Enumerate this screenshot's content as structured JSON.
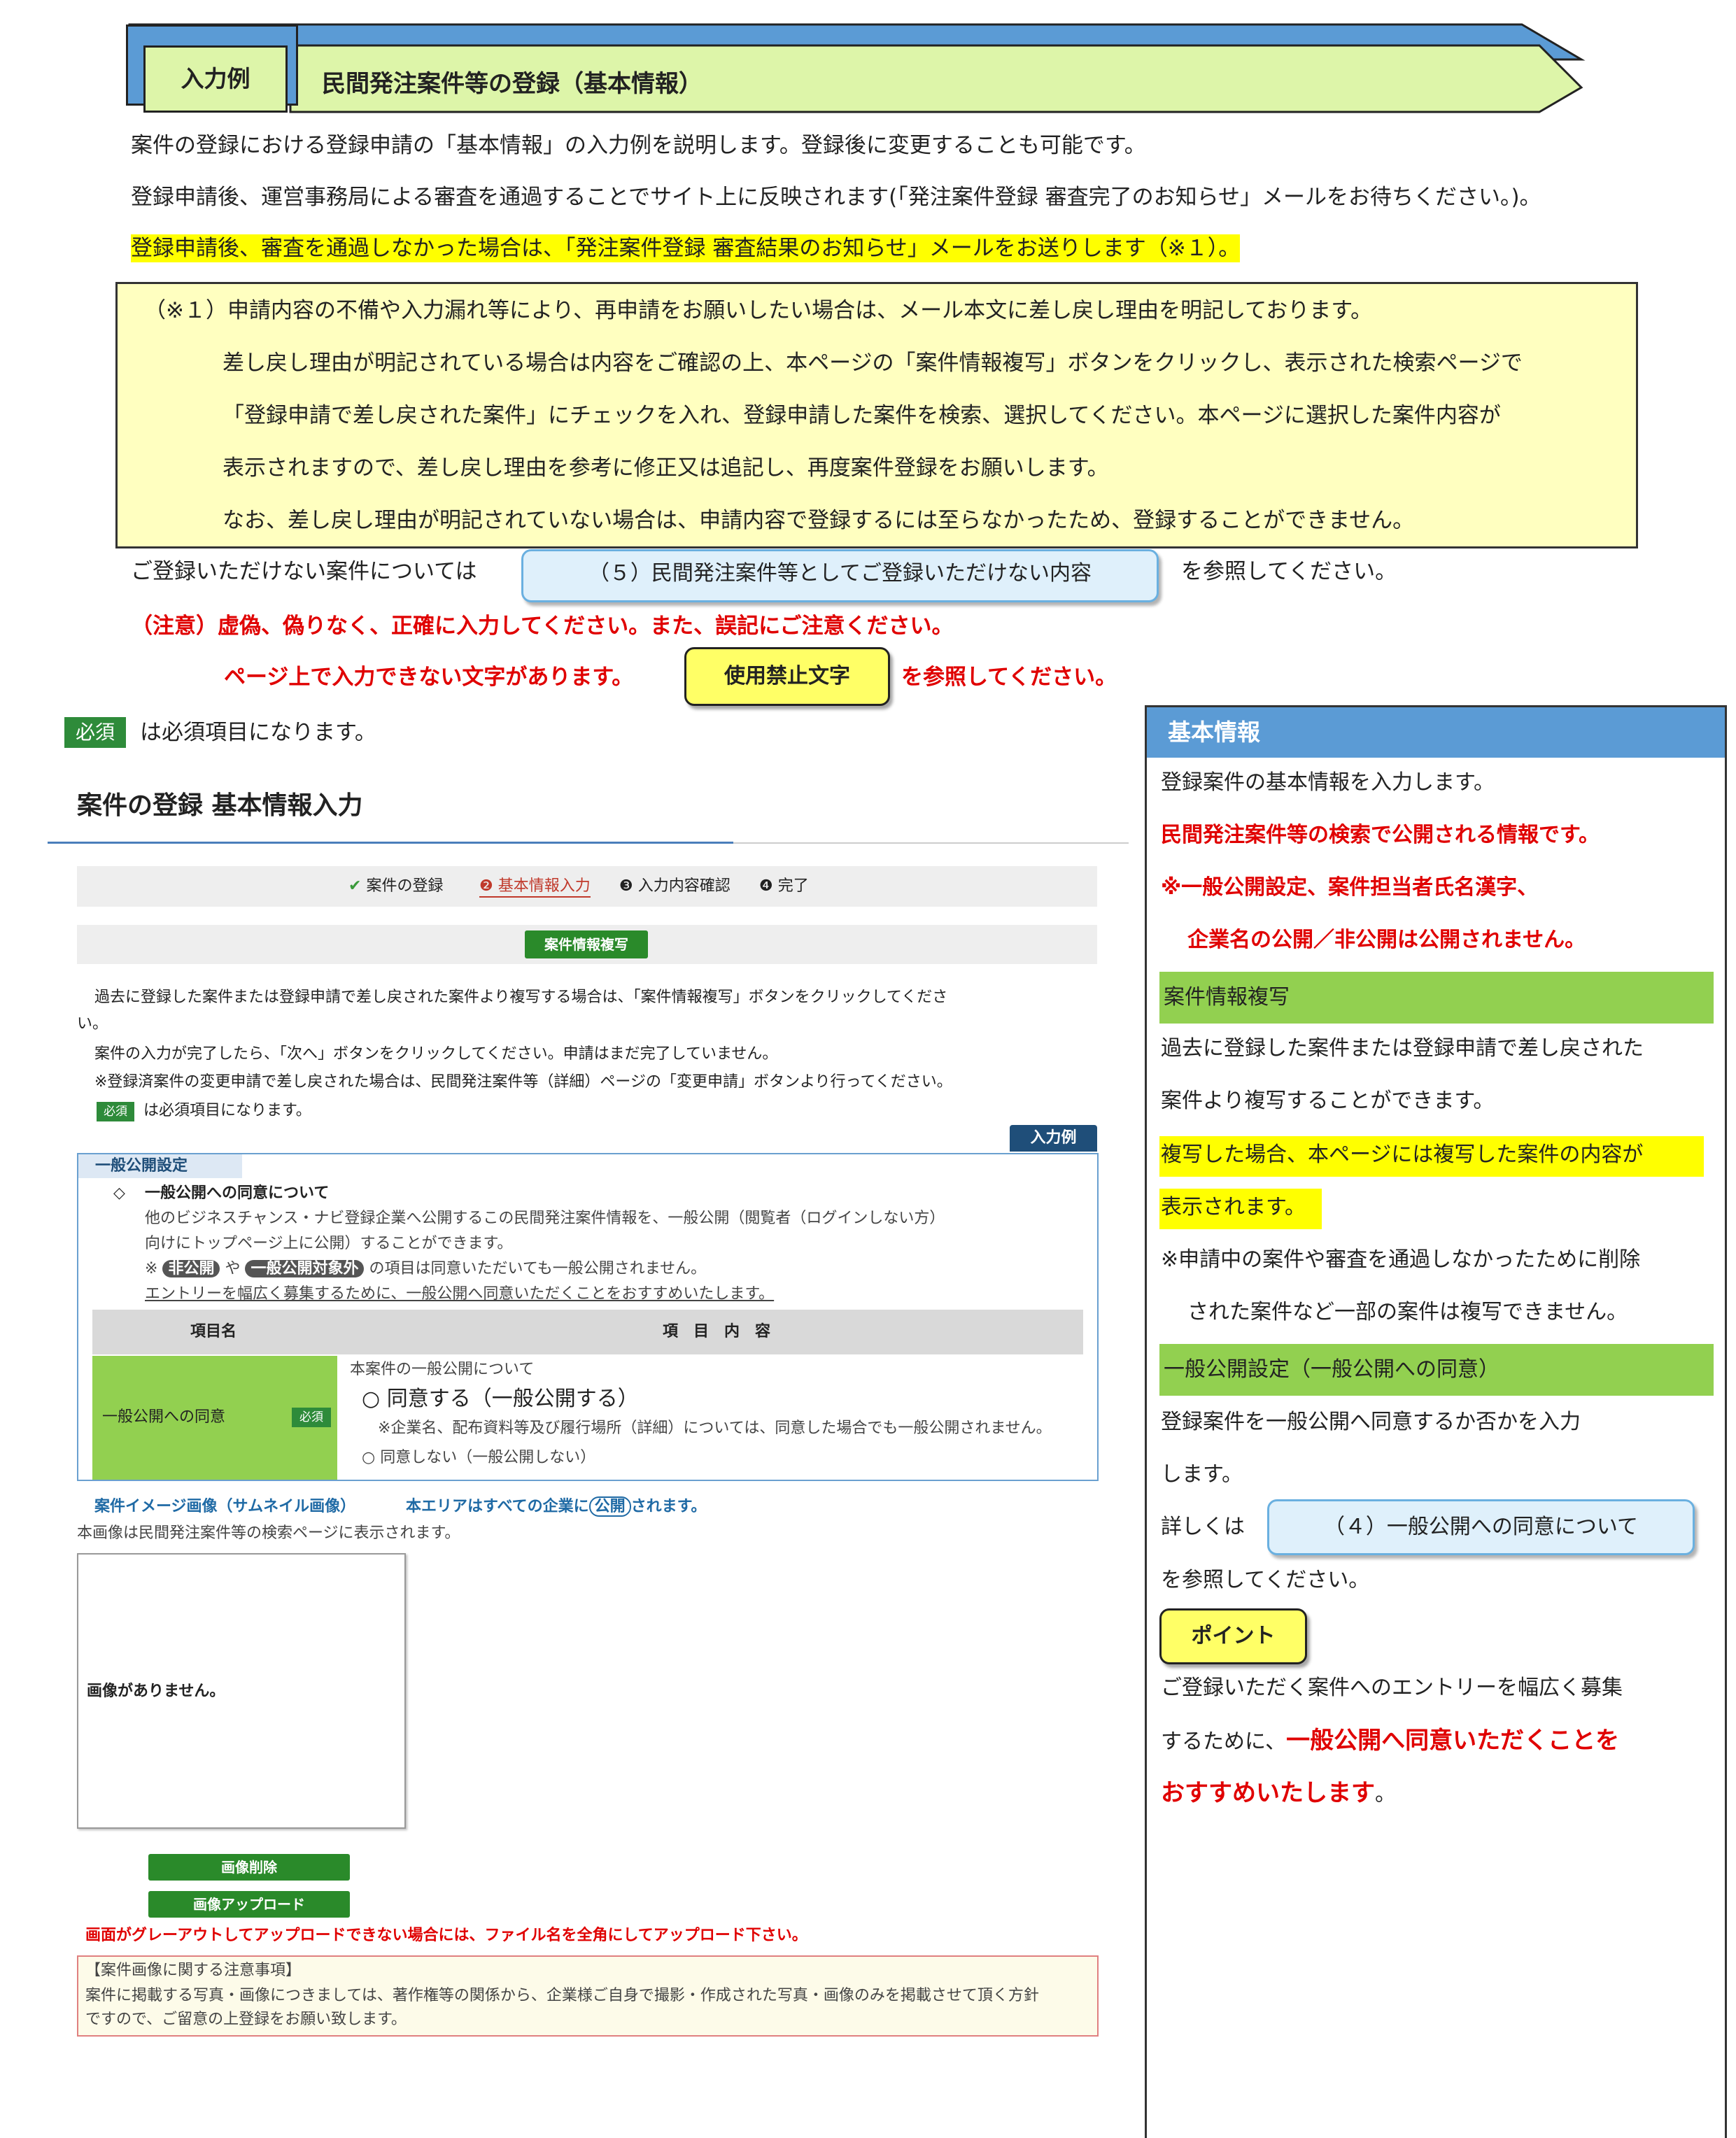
{
  "banner": {
    "tag": "入力例",
    "title": "民間発注案件等の登録（基本情報）"
  },
  "intro": {
    "line1": "案件の登録における登録申請の「基本情報」の入力例を説明します。登録後に変更することも可能です。",
    "line2": "登録申請後、運営事務局による審査を通過することでサイト上に反映されます(「発注案件登録 審査完了のお知らせ」メールをお待ちください。)。",
    "line3": "登録申請後、審査を通過しなかった場合は、「発注案件登録 審査結果のお知らせ」メールをお送りします（※１）。"
  },
  "note_box": {
    "l1": "（※１）申請内容の不備や入力漏れ等により、再申請をお願いしたい場合は、メール本文に差し戻し理由を明記しております。",
    "l2": "差し戻し理由が明記されている場合は内容をご確認の上、本ページの「案件情報複写」ボタンをクリックし、表示された検索ページで",
    "l3": "「登録申請で差し戻された案件」にチェックを入れ、登録申請した案件を検索、選択してください。本ページに選択した案件内容が",
    "l4": "表示されますので、差し戻し理由を参考に修正又は追記し、再度案件登録をお願いします。",
    "l5": "なお、差し戻し理由が明記されていない場合は、申請内容で登録するには至らなかったため、登録することができません。"
  },
  "refer": {
    "before": "ご登録いただけない案件については",
    "link": "（５）民間発注案件等としてご登録いただけない内容",
    "after": "を参照してください。"
  },
  "caution": {
    "l1": "（注意）虚偽、偽りなく、正確に入力してください。また、誤記にご注意ください。",
    "l2": "ページ上で入力できない文字があります。",
    "btn": "使用禁止文字",
    "l2b": "を参照してください。"
  },
  "must_badge": "必須",
  "must_text": "は必須項目になります。",
  "form": {
    "title": "案件の登録 基本情報入力",
    "steps": [
      "案件の登録",
      "基本情報入力",
      "入力内容確認",
      "完了"
    ],
    "copy_btn": "案件情報複写",
    "desc1": "過去に登録した案件または登録申請で差し戻された案件より複写する場合は、「案件情報複写」ボタンをクリックしてくださ",
    "desc1b": "い。",
    "desc2": "案件の入力が完了したら、「次へ」ボタンをクリックしてください。申請はまだ完了していません。",
    "desc3": "※登録済案件の変更申請で差し戻された場合は、民間発注案件等（詳細）ページの「変更申請」ボタンより行ってください。",
    "must_small": "必須",
    "must_small_text": "は必須項目になります。",
    "example_tag": "入力例",
    "pub": {
      "head": "一般公開設定",
      "sub": "一般公開への同意について",
      "p1": "他のビジネスチャンス・ナビ登録企業へ公開するこの民間発注案件情報を、一般公開（閲覧者（ログインしない方）",
      "p2": "向けにトップページ上に公開）することができます。",
      "p3a": "※",
      "chip1": "非公開",
      "p3b": "や",
      "chip2": "一般公開対象外",
      "p3c": "の項目は同意いただいても一般公開されません。",
      "p4": "エントリーを幅広く募集するために、一般公開へ同意いただくことをおすすめいたします。",
      "col1": "項目名",
      "col2": "項　目　内　容",
      "row_label": "一般公開への同意",
      "row_must": "必須",
      "r1": "本案件の一般公開について",
      "opt1": "○ 同意する（一般公開する）",
      "opt1_note": "※企業名、配布資料等及び履行場所（詳細）については、同意した場合でも一般公開されません。",
      "opt2": "○ 同意しない（一般公開しない）"
    },
    "image": {
      "head": "案件イメージ画像（サムネイル画像）",
      "area": "本エリアはすべての企業に",
      "public": "公開",
      "area2": "されます。",
      "desc": "本画像は民間発注案件等の検索ページに表示されます。",
      "none": "画像がありません。",
      "del": "画像削除",
      "up": "画像アップロード",
      "warn": "画面がグレーアウトしてアップロードできない場合には、ファイル名を全角にしてアップロード下さい。",
      "notice_title": "【案件画像に関する注意事項】",
      "notice1": "案件に掲載する写真・画像につきましては、著作権等の関係から、企業様ご自身で撮影・作成された写真・画像のみを掲載させて頂く方針",
      "notice2": "ですので、ご留意の上登録をお願い致します。"
    }
  },
  "side": {
    "head": "基本情報",
    "s1": "登録案件の基本情報を入力します。",
    "s2": "民間発注案件等の検索で公開される情報です。",
    "s3": "※一般公開設定、案件担当者氏名漢字、",
    "s4": "企業名の公開／非公開は公開されません。",
    "g1": "案件情報複写",
    "s5": "過去に登録した案件または登録申請で差し戻された",
    "s6": "案件より複写することができます。",
    "s7": "複写した場合、本ページには複写した案件の内容が",
    "s8": "表示されます。",
    "s9": "※申請中の案件や審査を通過しなかったために削除",
    "s10": "された案件など一部の案件は複写できません。",
    "g2": "一般公開設定（一般公開への同意）",
    "s11": "登録案件を一般公開へ同意するか否かを入力",
    "s12": "します。",
    "s13": "詳しくは",
    "link": "（４）一般公開への同意について",
    "s14": "を参照してください。",
    "point": "ポイント",
    "s15": "ご登録いただく案件へのエントリーを幅広く募集",
    "s16a": "するために、",
    "s16b": "一般公開へ同意いただくことを",
    "s17a": "おすすめいたします",
    "s17b": "。"
  },
  "colors": {
    "accent_green": "#92d050",
    "side_head": "#5b9bd5",
    "must": "#2e8b3a",
    "tag_bg": "#ddf5a9"
  }
}
